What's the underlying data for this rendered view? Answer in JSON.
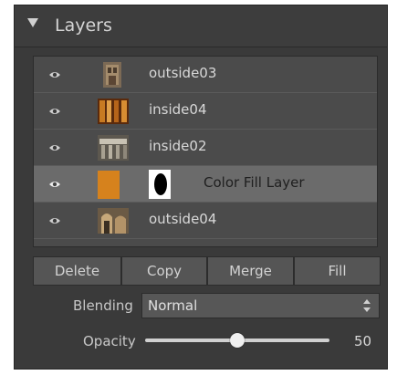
{
  "panel": {
    "title": "Layers"
  },
  "layers": [
    {
      "label": "outside03",
      "thumb": "stone-building-thumbnail",
      "selected": false
    },
    {
      "label": "inside04",
      "thumb": "church-interior-thumbnail",
      "selected": false
    },
    {
      "label": "inside02",
      "thumb": "hall-interior-thumbnail",
      "selected": false
    },
    {
      "label": "Color Fill Layer",
      "thumb": "color-fill-swatch",
      "selected": true,
      "fill_color": "#d6821d"
    },
    {
      "label": "outside04",
      "thumb": "arched-cloister-thumbnail",
      "selected": false
    }
  ],
  "buttons": {
    "delete": "Delete",
    "copy": "Copy",
    "merge": "Merge",
    "fill": "Fill"
  },
  "blending": {
    "label": "Blending",
    "value": "Normal"
  },
  "opacity": {
    "label": "Opacity",
    "value": "50",
    "level": 0.5
  },
  "colors": {
    "panel_bg": "#3a3a3a",
    "list_bg": "#4b4b4b",
    "selected_row": "#6b6b6b",
    "fill_swatch": "#d6821d"
  }
}
